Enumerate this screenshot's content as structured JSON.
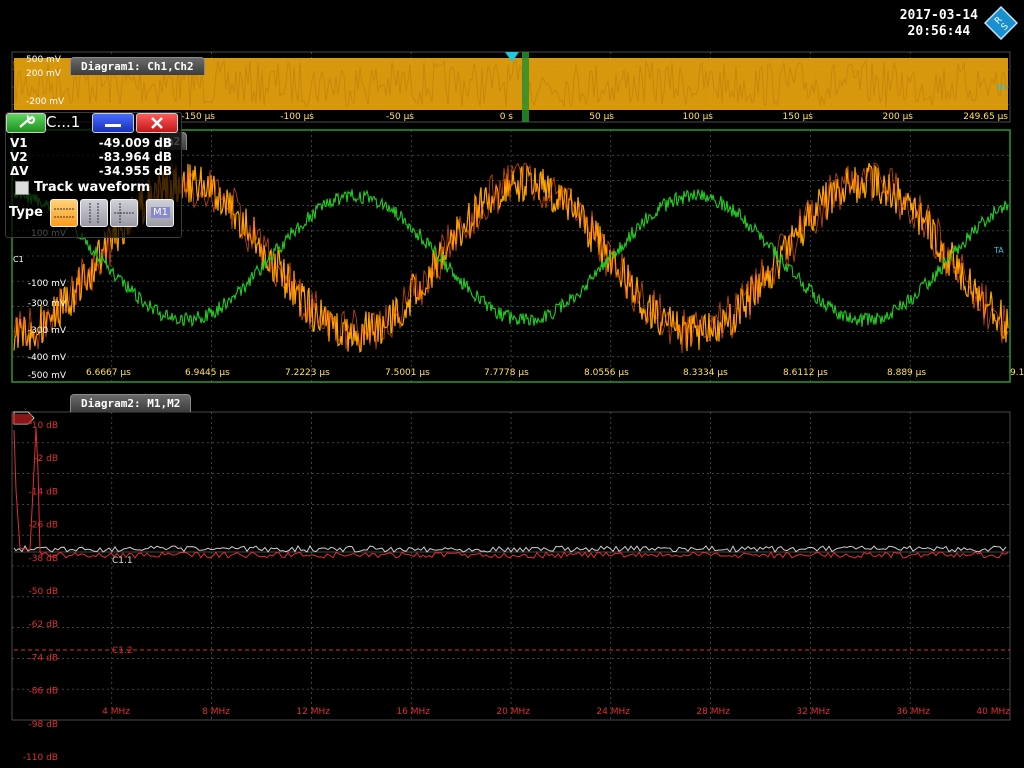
{
  "header": {
    "date": "2017-03-14",
    "time": "20:56:44"
  },
  "diagram1": {
    "title": "Diagram1: Ch1,Ch2",
    "y_ticks": [
      "500 mV",
      "200 mV",
      "",
      "-200 mV"
    ],
    "x_ticks": [
      "-150 µs",
      "-100 µs",
      "-50 µs",
      "0 s",
      "50 µs",
      "100 µs",
      "150 µs",
      "200 µs",
      "249.65 µs"
    ]
  },
  "zoom": {
    "title_partial": "h2",
    "y_ticks": [
      "",
      "",
      "",
      "100 mV",
      "",
      "-100 mV",
      "-300 mV",
      "-300 mV",
      "-400 mV",
      "-500 mV"
    ],
    "x_ticks": [
      "6.6667 µs",
      "6.9445 µs",
      "7.2223 µs",
      "7.5001 µs",
      "7.7778 µs",
      "8.0556 µs",
      "8.3334 µs",
      "8.6112 µs",
      "8.889 µs",
      "9.1806 µs"
    ]
  },
  "diagram2": {
    "title": "Diagram2: M1,M2",
    "y_ticks": [
      "10 dB",
      "-2 dB",
      "-14 dB",
      "-26 dB",
      "-38 dB",
      "-50 dB",
      "-62 dB",
      "-74 dB",
      "-86 dB",
      "-98 dB",
      "-110 dB"
    ],
    "x_ticks": [
      "4 MHz",
      "8 MHz",
      "12 MHz",
      "16 MHz",
      "20 MHz",
      "24 MHz",
      "28 MHz",
      "32 MHz",
      "36 MHz",
      "40 MHz"
    ],
    "cursor_c11": "C1.1",
    "cursor_c12": "C1.2"
  },
  "cursor_panel": {
    "title": "C...1",
    "v1_label": "V1",
    "v1_value": "-49.009 dB",
    "v2_label": "V2",
    "v2_value": "-83.964 dB",
    "dv_label": "ΔV",
    "dv_value": "-34.955 dB",
    "track_label": "Track waveform",
    "type_label": "Type",
    "m1_label": "M1"
  },
  "markers": {
    "ta": "TA",
    "c1": "C1"
  },
  "colors": {
    "ch1": "#ffa500",
    "ch2": "#22cc22",
    "m1": "#e03030",
    "m2": "#cfcfcf",
    "trigger": "#22c8e0"
  }
}
